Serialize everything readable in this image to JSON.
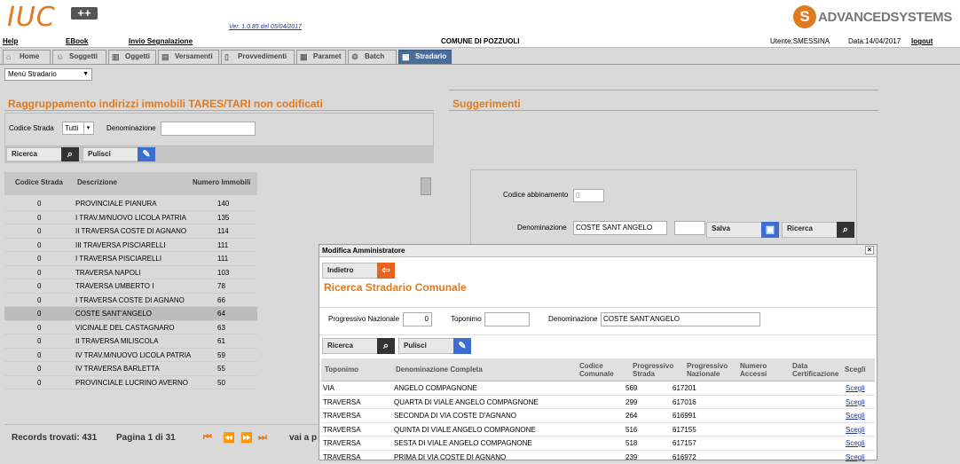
{
  "header": {
    "logo": "IUC",
    "logo_plus": "++",
    "version": "Ver. 1.0.85 del 05/04/2017",
    "brand": "ADVANCEDSYSTEMS"
  },
  "menubar": {
    "help": "Help",
    "ebook": "EBook",
    "invio": "Invio Segnalazione",
    "comune": "COMUNE DI POZZUOLI",
    "utente": "Utente:SMESSINA",
    "data": "Data:14/04/2017",
    "logout": "logout"
  },
  "tabs": [
    {
      "label": "Home",
      "icon": "home-icon"
    },
    {
      "label": "Soggetti",
      "icon": "person-icon"
    },
    {
      "label": "Oggetti",
      "icon": "building-icon"
    },
    {
      "label": "Versamenti",
      "icon": "payment-icon"
    },
    {
      "label": "Provvedimenti",
      "icon": "document-icon"
    },
    {
      "label": "Paramet",
      "icon": "table-icon"
    },
    {
      "label": "Batch",
      "icon": "gears-icon"
    },
    {
      "label": "Stradario",
      "icon": "grid-icon"
    }
  ],
  "menu_select": "Menù Stradario",
  "left": {
    "title": "Raggruppamento indirizzi immobili TARES/TARI non codificati",
    "codice_label": "Codice Strada",
    "codice_value": "Tutti",
    "denom_label": "Denominazione",
    "denom_value": "",
    "ricerca": "Ricerca",
    "pulisci": "Pulisci",
    "columns": [
      "Codice Strada",
      "Descrizione",
      "Numero Immobili"
    ],
    "rows": [
      [
        "0",
        "PROVINCIALE PIANURA",
        "140"
      ],
      [
        "0",
        "I TRAV.M/NUOVO LICOLA PATRIA",
        "135"
      ],
      [
        "0",
        "II TRAVERSA COSTE DI AGNANO",
        "114"
      ],
      [
        "0",
        "III TRAVERSA PISCIARELLI",
        "111"
      ],
      [
        "0",
        "I TRAVERSA PISCIARELLI",
        "111"
      ],
      [
        "0",
        "TRAVERSA NAPOLI",
        "103"
      ],
      [
        "0",
        "TRAVERSA UMBERTO I",
        "78"
      ],
      [
        "0",
        "I TRAVERSA COSTE DI AGNANO",
        "66"
      ],
      [
        "0",
        "COSTE SANT'ANGELO",
        "64"
      ],
      [
        "0",
        "VICINALE DEL CASTAGNARO",
        "63"
      ],
      [
        "0",
        "II TRAVERSA MILISCOLA",
        "61"
      ],
      [
        "0",
        "IV TRAV.M/NUOVO LICOLA PATRIA",
        "59"
      ],
      [
        "0",
        "IV TRAVERSA BARLETTA",
        "55"
      ],
      [
        "0",
        "PROVINCIALE LUCRINO AVERNO",
        "50"
      ]
    ],
    "records": "Records trovati: 431",
    "pagina": "Pagina 1 di 31",
    "vai": "vai a p"
  },
  "right": {
    "title": "Suggerimenti",
    "codice_abb_label": "Codice abbinamento",
    "codice_abb_value": "0",
    "denom_label": "Denominazione",
    "denom_value": "COSTE SANT ANGELO",
    "extra_value": "",
    "salva": "Salva",
    "ricerca": "Ricerca"
  },
  "modal": {
    "title": "Modifica Amministratore",
    "indietro": "Indietro",
    "heading": "Ricerca Stradario Comunale",
    "prog_naz_label": "Progressivo Nazionale",
    "prog_naz_value": "0",
    "toponimo_label": "Toponimo",
    "toponimo_value": "",
    "denom_label": "Denominazione",
    "denom_value": "COSTE SANT'ANGELO",
    "ricerca": "Ricerca",
    "pulisci": "Pulisci",
    "columns": {
      "c1": "Toponimo",
      "c2": "Denominazione Completa",
      "c3a": "Codice",
      "c3b": "Comunale",
      "c4a": "Progressivo",
      "c4b": "Strada",
      "c5a": "Progressivo",
      "c5b": "Nazionale",
      "c6a": "Numero",
      "c6b": "Accessi",
      "c7a": "Data",
      "c7b": "Certificazione",
      "c8": "Scegli"
    },
    "rows": [
      [
        "VIA",
        "ANGELO COMPAGNONE",
        "569",
        "617201",
        "Scegli"
      ],
      [
        "TRAVERSA",
        "QUARTA DI VIALE ANGELO COMPAGNONE",
        "299",
        "617016",
        "Scegli"
      ],
      [
        "TRAVERSA",
        "SECONDA DI VIA COSTE D'AGNANO",
        "264",
        "616991",
        "Scegli"
      ],
      [
        "TRAVERSA",
        "QUINTA DI VIALE ANGELO COMPAGNONE",
        "516",
        "617155",
        "Scegli"
      ],
      [
        "TRAVERSA",
        "SESTA DI VIALE ANGELO COMPAGNONE",
        "518",
        "617157",
        "Scegli"
      ],
      [
        "TRAVERSA",
        "PRIMA DI VIA COSTE DI AGNANO",
        "239",
        "616972",
        "Scegli"
      ]
    ]
  },
  "colors": {
    "accent": "#e07a1f",
    "active_tab": "#4a6d9c",
    "link": "#1a35a8"
  }
}
